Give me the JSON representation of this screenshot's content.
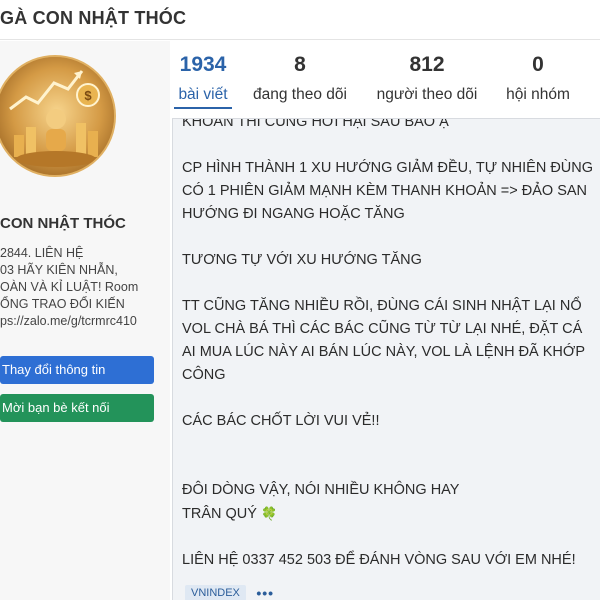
{
  "header": {
    "title": "GÀ CON NHẬT THÓC"
  },
  "profile": {
    "name": "CON NHẬT THÓC",
    "bio_lines": [
      "  2844.  LIÊN  HỆ",
      "03 HÃY KIÊN NHẪN,",
      "OÀN VÀ KỈ LUẬT! Room",
      "ỔNG TRAO ĐỔI KIẾN",
      "ps://zalo.me/g/tcrmrc410"
    ],
    "edit_button": "Thay đổi thông tin",
    "invite_button": "Mời bạn bè kết nối"
  },
  "stats": [
    {
      "value": "1934",
      "label": "bài viết",
      "active": true
    },
    {
      "value": "8",
      "label": "đang theo dõi",
      "active": false
    },
    {
      "value": "812",
      "label": "người theo dõi",
      "active": false
    },
    {
      "value": "0",
      "label": "hội nhóm",
      "active": false
    }
  ],
  "post": {
    "lines": [
      "KHOẢN THÌ CŨNG HƠI HẠI SAU BẢO Ạ",
      "",
      "CP HÌNH THÀNH 1 XU HƯỚNG GIẢM ĐỀU, TỰ NHIÊN ĐÙNG",
      "CÓ 1 PHIÊN GIẢM MẠNH KÈM THANH KHOẢN => ĐẢO SAN",
      "HƯỚNG ĐI NGANG HOẶC TĂNG",
      "",
      "TƯƠNG TỰ VỚI XU HƯỚNG TĂNG",
      "",
      "TT CŨNG TĂNG NHIỀU RỒI, ĐÙNG CÁI SINH NHẬT LẠI NỔ",
      "VOL CHÀ BÁ THÌ CÁC BÁC CŨNG TỪ TỪ LẠI NHÉ, ĐẶT CÁ",
      "AI MUA LÚC NÀY AI BÁN LÚC NÀY, VOL LÀ LỆNH ĐÃ KHỚP",
      "CÔNG",
      "",
      "CÁC BÁC CHỐT LỜI VUI VẺ!!",
      "",
      "",
      "ĐÔI DÒNG VẬY, NÓI NHIỀU KHÔNG HAY",
      "TRÂN QUÝ",
      "",
      "LIÊN HỆ 0337 452 503 ĐỂ ĐÁNH VÒNG SAU VỚI EM NHÉ!"
    ],
    "clover": "🍀",
    "tag": "VNINDEX",
    "more": "•••"
  },
  "colors": {
    "accent": "#2b63a9",
    "primary_button": "#2e6fd4",
    "success_button": "#23935a"
  }
}
